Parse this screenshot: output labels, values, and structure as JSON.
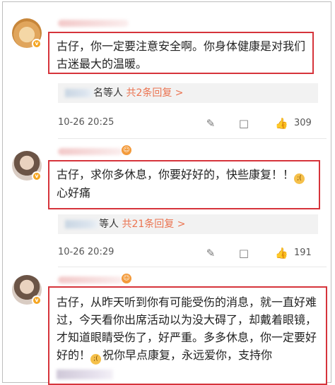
{
  "comments": [
    {
      "text": "古仔，你一定要注意安全啊。你身体健康是对我们古迷最大的温暖。",
      "reply_suffix": "名等人",
      "reply_link": "共2条回复 >",
      "time": "10-26 20:25",
      "likes": "309"
    },
    {
      "text_main": "古仔，求你多休息，你要好好的，快些康复！！",
      "text_tail": "心好痛",
      "reply_suffix": "等人",
      "reply_link": "共21条回复 >",
      "time": "10-26 20:29",
      "likes": "191"
    },
    {
      "text_main": "古仔，从昨天听到你有可能受伤的消息，就一直好难过，今天看你出席活动以为没大碍了，却戴着眼镜，才知道眼睛受伤了，好严重。多多休息，你一定要好好的！",
      "text_tail": "祝你早点康复，永远爱你，支持你"
    }
  ],
  "icons": {
    "share": "share-icon",
    "comment": "comment-icon",
    "like": "thumbs-up-icon",
    "verified": "verified-badge-icon",
    "emoji": "crying-emoji-icon"
  },
  "colors": {
    "highlight_border": "#d6343b",
    "reply_link": "#eb7350",
    "verified": "#f5a623"
  }
}
